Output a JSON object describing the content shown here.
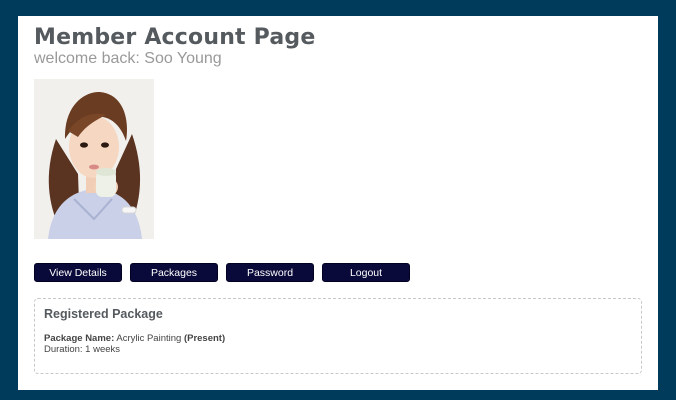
{
  "page": {
    "title": "Member Account Page",
    "welcome": "welcome back: Soo Young"
  },
  "profile": {
    "avatar_icon": "profile-photo"
  },
  "nav": {
    "items": [
      {
        "label": "View Details"
      },
      {
        "label": "Packages"
      },
      {
        "label": "Password"
      },
      {
        "label": "Logout"
      }
    ]
  },
  "package": {
    "heading": "Registered Package",
    "name_label": "Package Name:",
    "name_value": "Acrylic Painting",
    "status": "(Present)",
    "duration": "Duration: 1 weeks"
  },
  "colors": {
    "background": "#003b5c",
    "panel": "#ffffff",
    "button": "#0a0a3a",
    "title": "#555a5f",
    "subtitle": "#999999"
  }
}
